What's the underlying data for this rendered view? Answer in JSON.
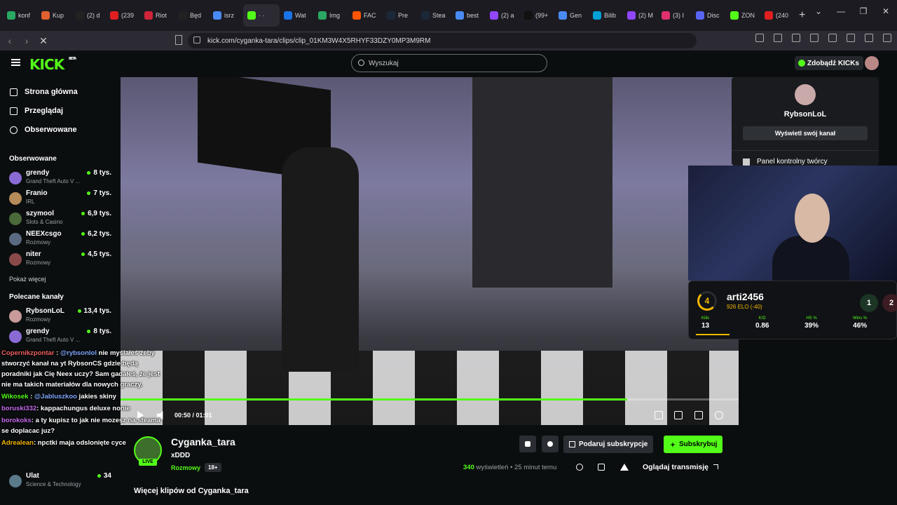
{
  "browser": {
    "tabs": [
      {
        "label": "konf",
        "color": "#29a861"
      },
      {
        "label": "Kup",
        "color": "#e06030"
      },
      {
        "label": "(2) d",
        "color": "#222222"
      },
      {
        "label": "(239",
        "color": "#e02020"
      },
      {
        "label": "Riot",
        "color": "#d0243a"
      },
      {
        "label": "Będ",
        "color": "#222222"
      },
      {
        "label": "isrz",
        "color": "#4a8af4"
      },
      {
        "label": "· ·",
        "color": "#53fc18"
      },
      {
        "label": "Wat",
        "color": "#1b73e8"
      },
      {
        "label": "Img",
        "color": "#29a861"
      },
      {
        "label": "FAC",
        "color": "#ff5500"
      },
      {
        "label": "Pre",
        "color": "#1b2838"
      },
      {
        "label": "Stea",
        "color": "#1b2838"
      },
      {
        "label": "best",
        "color": "#4a8af4"
      },
      {
        "label": "(2) a",
        "color": "#9146ff"
      },
      {
        "label": "(99+",
        "color": "#111111"
      },
      {
        "label": "Gen",
        "color": "#4a8af4"
      },
      {
        "label": "Bilib",
        "color": "#00a1d6"
      },
      {
        "label": "(2) M",
        "color": "#9146ff"
      },
      {
        "label": "(3) I",
        "color": "#e1306c"
      },
      {
        "label": "Disc",
        "color": "#5865f2"
      },
      {
        "label": "ZON",
        "color": "#53fc18"
      },
      {
        "label": "(240",
        "color": "#e02020"
      }
    ],
    "url": "kick.com/cyganka-tara/clips/clip_01KM3W4X5RHYF33DZY0MP3M9RM"
  },
  "header": {
    "logo": "KICK",
    "logo_tag": "BETA",
    "search_placeholder": "Wyszukaj",
    "kicks_button": "Zdobądź KICKs"
  },
  "sidebar": {
    "nav": [
      {
        "label": "Strona główna",
        "icon": "home-icon"
      },
      {
        "label": "Przeglądaj",
        "icon": "browse-icon"
      },
      {
        "label": "Obserwowane",
        "icon": "heart-icon"
      }
    ],
    "followed_title": "Obserwowane",
    "followed": [
      {
        "name": "grendy",
        "category": "Grand Theft Auto V ...",
        "viewers": "8 tys.",
        "color": "#8a6bd6"
      },
      {
        "name": "Franio",
        "category": "IRL",
        "viewers": "7 tys.",
        "color": "#b58b5a"
      },
      {
        "name": "szymool",
        "category": "Slots & Casino",
        "viewers": "6,9 tys.",
        "color": "#4a6a3a"
      },
      {
        "name": "NEEXcsgo",
        "category": "Rozmowy",
        "viewers": "6,2 tys.",
        "color": "#5a6a80"
      },
      {
        "name": "niter",
        "category": "Rozmowy",
        "viewers": "4,5 tys.",
        "color": "#8a4a4a"
      }
    ],
    "show_more": "Pokaż więcej",
    "recommended_title": "Polecane kanały",
    "recommended": [
      {
        "name": "RybsonLoL",
        "category": "Rozmowy",
        "viewers": "13,4 tys.",
        "color": "#c99a9a"
      },
      {
        "name": "grendy",
        "category": "Grand Theft Auto V ...",
        "viewers": "8 tys.",
        "color": "#8a6bd6"
      }
    ],
    "bottom": [
      {
        "name": "Ulat",
        "category": "Science & Technology",
        "viewers": "34",
        "color": "#5a7a8a"
      }
    ]
  },
  "video": {
    "time": "00:50 / 01:01",
    "progress": 0.82
  },
  "dropdown": {
    "username": "RybsonLoL",
    "view_channel": "Wyświetl swój kanał",
    "creator_panel": "Panel kontrolny twórcy"
  },
  "stat_card": {
    "level": "4",
    "player": "arti2456",
    "elo": "926 ELO (-40)",
    "rank1": "1",
    "rank2": "2",
    "stats": [
      {
        "key": "Kills",
        "value": "13"
      },
      {
        "key": "K/D",
        "value": "0.86"
      },
      {
        "key": "HS %",
        "value": "39%"
      },
      {
        "key": "Wins %",
        "value": "46%"
      }
    ]
  },
  "chat": [
    {
      "user": "Copernikzpontar",
      "mention": "@rybsonlol",
      "text": " nie myślałeś żeby stworzyć kanał na yt RybsonCS gdzie będą poradniki jak Cię Neex uczy? Sam gadałeś, że jest nie ma takich materiałów dla nowych graczy."
    },
    {
      "user": "Wikosek",
      "mention": "@Jabluszkoo",
      "text": " jakies skiny"
    },
    {
      "user": "boruski332",
      "mention": "",
      "text": ": kappachungus deluxe nonie"
    },
    {
      "user": "borokoks",
      "mention": "",
      "text": ": a ty kupisz to jak nie mozesz na steama se doplacac juz?"
    },
    {
      "user": "Adrealean",
      "mention": "",
      "text": ": npctki maja odslonięte cyce"
    }
  ],
  "clip": {
    "channel": "Cyganka_tara",
    "title": "xDDD",
    "category": "Rozmowy",
    "age": "18+",
    "live": "LIVE",
    "gift_sub": "Podaruj subskrypcje",
    "subscribe": "Subskrybuj",
    "views_count": "340",
    "views_label": " wyświetleń",
    "time_ago": " • 25 minut temu",
    "watch_stream": "Oglądaj transmisję",
    "more_clips": "Więcej klipów od Cyganka_tara"
  }
}
